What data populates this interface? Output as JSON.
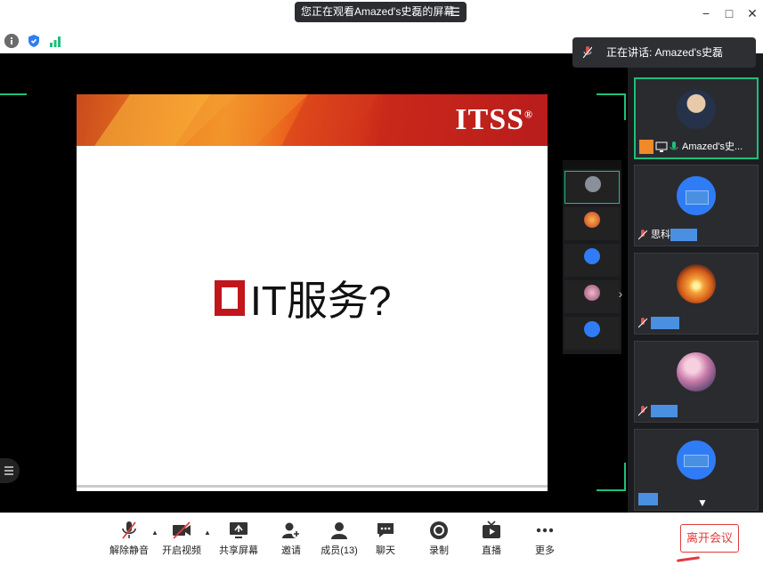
{
  "titlebar": {
    "share_notice": "您正在观看Amazed's史磊的屏幕",
    "menu_icon": "menu-icon"
  },
  "window_controls": {
    "minimize": "−",
    "maximize": "□",
    "close": "✕"
  },
  "speaking": {
    "text": "正在讲话: Amazed's史磊"
  },
  "slide": {
    "logo": "ITSS",
    "logo_mark": "®",
    "title": "IT服务?"
  },
  "participants": [
    {
      "name": "Amazed's史...",
      "active": true
    },
    {
      "name": "思科",
      "active": false
    },
    {
      "name": "",
      "active": false
    },
    {
      "name": "",
      "active": false
    },
    {
      "name": "",
      "active": false
    }
  ],
  "toolbar": {
    "unmute": "解除静音",
    "start_video": "开启视频",
    "share_screen": "共享屏幕",
    "invite": "邀请",
    "members": "成员(13)",
    "chat": "聊天",
    "record": "录制",
    "live": "直播",
    "more": "更多",
    "leave": "离开会议"
  },
  "colors": {
    "accent_green": "#1fbf7a",
    "leave_red": "#e03b3b",
    "brand_red": "#c0161c"
  }
}
